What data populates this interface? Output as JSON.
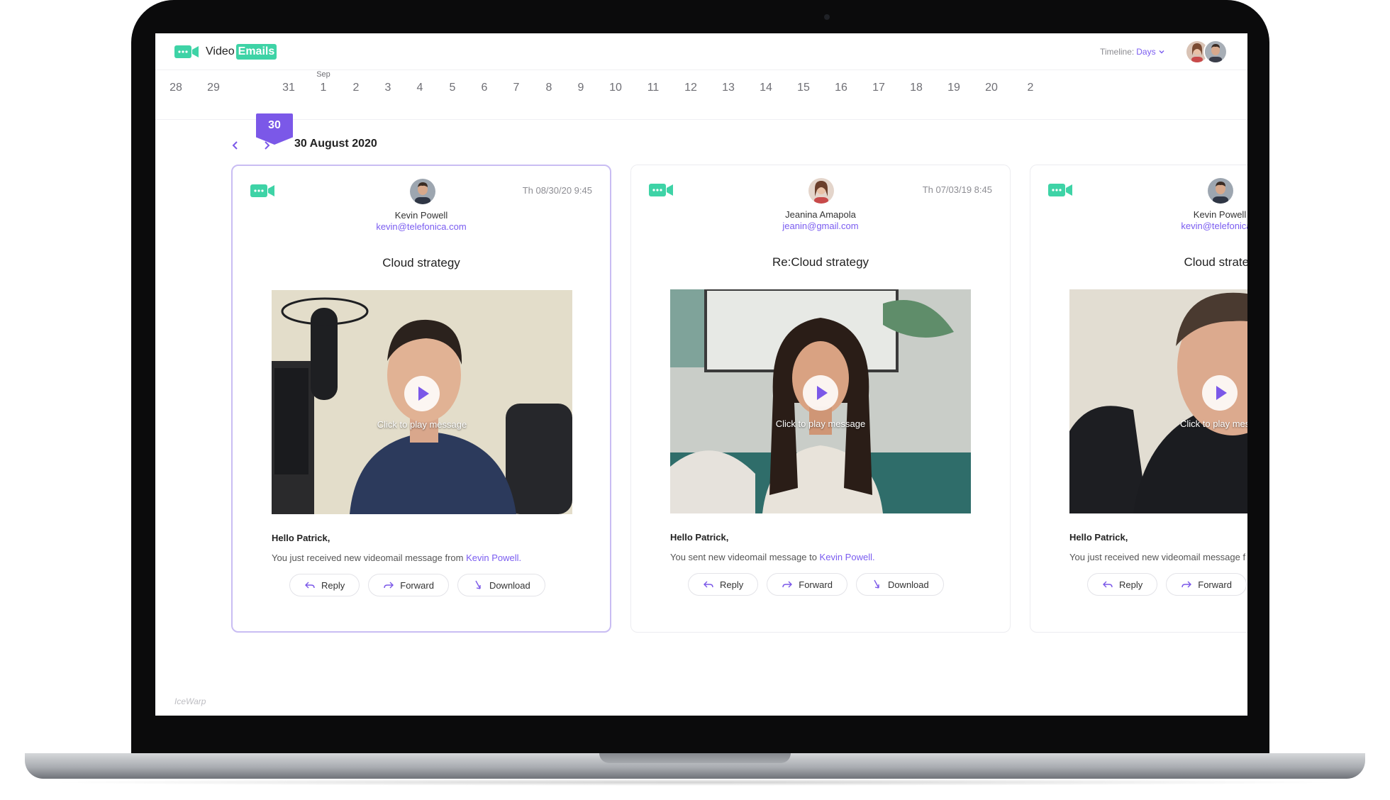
{
  "app": {
    "logo_text": "Video",
    "logo_badge": "Emails",
    "timeline_label": "Timeline:",
    "timeline_value": "Days"
  },
  "dates": {
    "month_label": "Sep",
    "days": [
      "28",
      "29",
      "30",
      "31",
      "1",
      "2",
      "3",
      "4",
      "5",
      "6",
      "7",
      "8",
      "9",
      "10",
      "11",
      "12",
      "13",
      "14",
      "15",
      "16",
      "17",
      "18",
      "19",
      "20",
      "2"
    ],
    "active": "30"
  },
  "day_nav": {
    "title": "30 August 2020"
  },
  "cards": [
    {
      "time": "Th 08/30/20 9:45",
      "sender": "Kevin Powell",
      "email": "kevin@telefonica.com",
      "subject": "Cloud strategy",
      "play_label": "Click to play message",
      "greeting": "Hello Patrick,",
      "message": "You just received new videomail message from",
      "message_link": "Kevin Powell.",
      "reply": "Reply",
      "forward": "Forward",
      "download": "Download"
    },
    {
      "time": "Th 07/03/19 8:45",
      "sender": "Jeanina Amapola",
      "email": "jeanin@gmail.com",
      "subject": "Re:Cloud strategy",
      "play_label": "Click to play message",
      "greeting": "Hello Patrick,",
      "message": "You sent new videomail message to",
      "message_link": "Kevin Powell.",
      "reply": "Reply",
      "forward": "Forward",
      "download": "Download"
    },
    {
      "sender": "Kevin Powell",
      "email": "kevin@telefonica.c",
      "subject": "Cloud strateg",
      "play_label": "Click to play messa",
      "greeting": "Hello Patrick,",
      "message": "You just received new videomail message f",
      "reply": "Reply",
      "forward": "Forward"
    }
  ],
  "footer": {
    "brand": "IceWarp"
  },
  "colors": {
    "accent": "#7b58e8",
    "brand_green": "#3ed3a6",
    "link": "#7a5cf0"
  }
}
